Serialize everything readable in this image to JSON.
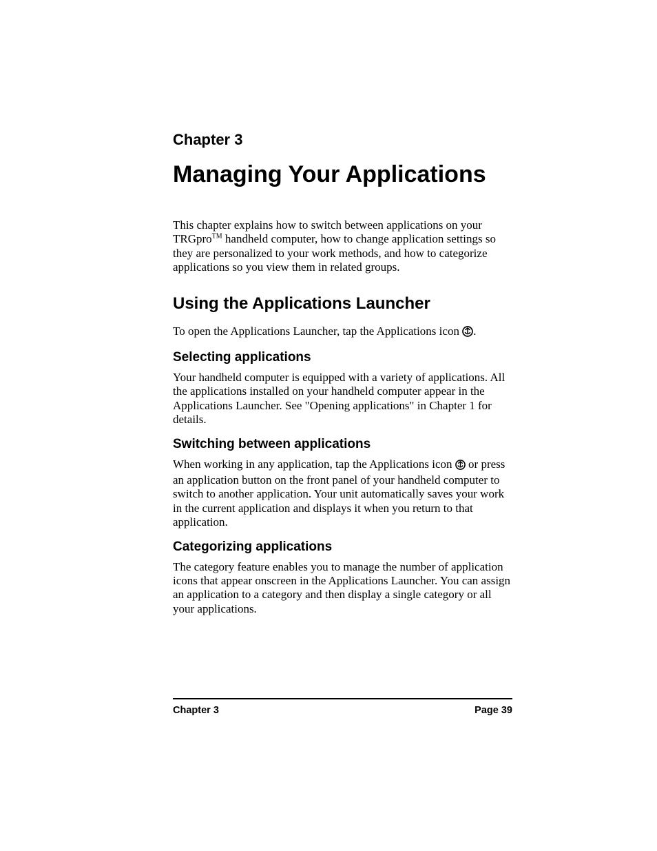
{
  "chapter_label": "Chapter 3",
  "chapter_title": "Managing Your Applications",
  "intro_para_a": "This chapter explains how to switch between applications on your TRGpro",
  "intro_para_tm": "TM",
  "intro_para_b": " handheld computer, how to change application settings so they are personalized to your work methods, and how to categorize applications so you view them in related groups.",
  "section1_heading": "Using the Applications Launcher",
  "section1_para_a": "To open the Applications Launcher, tap the Applications icon ",
  "section1_para_b": ".",
  "sub1_heading": "Selecting applications",
  "sub1_para": "Your  handheld computer is equipped with a variety of applications. All the applications installed on your handheld computer appear in the Applications Launcher. See \"Opening applications\" in Chapter 1 for details.",
  "sub2_heading": "Switching between applications",
  "sub2_para_a": "When working in any application, tap the Applications icon ",
  "sub2_para_b": " or press an application button on the front panel of your handheld computer to switch to another application. Your unit automatically saves your work in the current application and displays it when you return to that application.",
  "sub3_heading": "Categorizing applications",
  "sub3_para": "The category feature enables you to manage the number of application icons that appear onscreen in the Applications Launcher. You can assign an application to a category and then display a single category or all your applications.",
  "footer_chapter": "Chapter 3",
  "footer_page": "Page 39"
}
